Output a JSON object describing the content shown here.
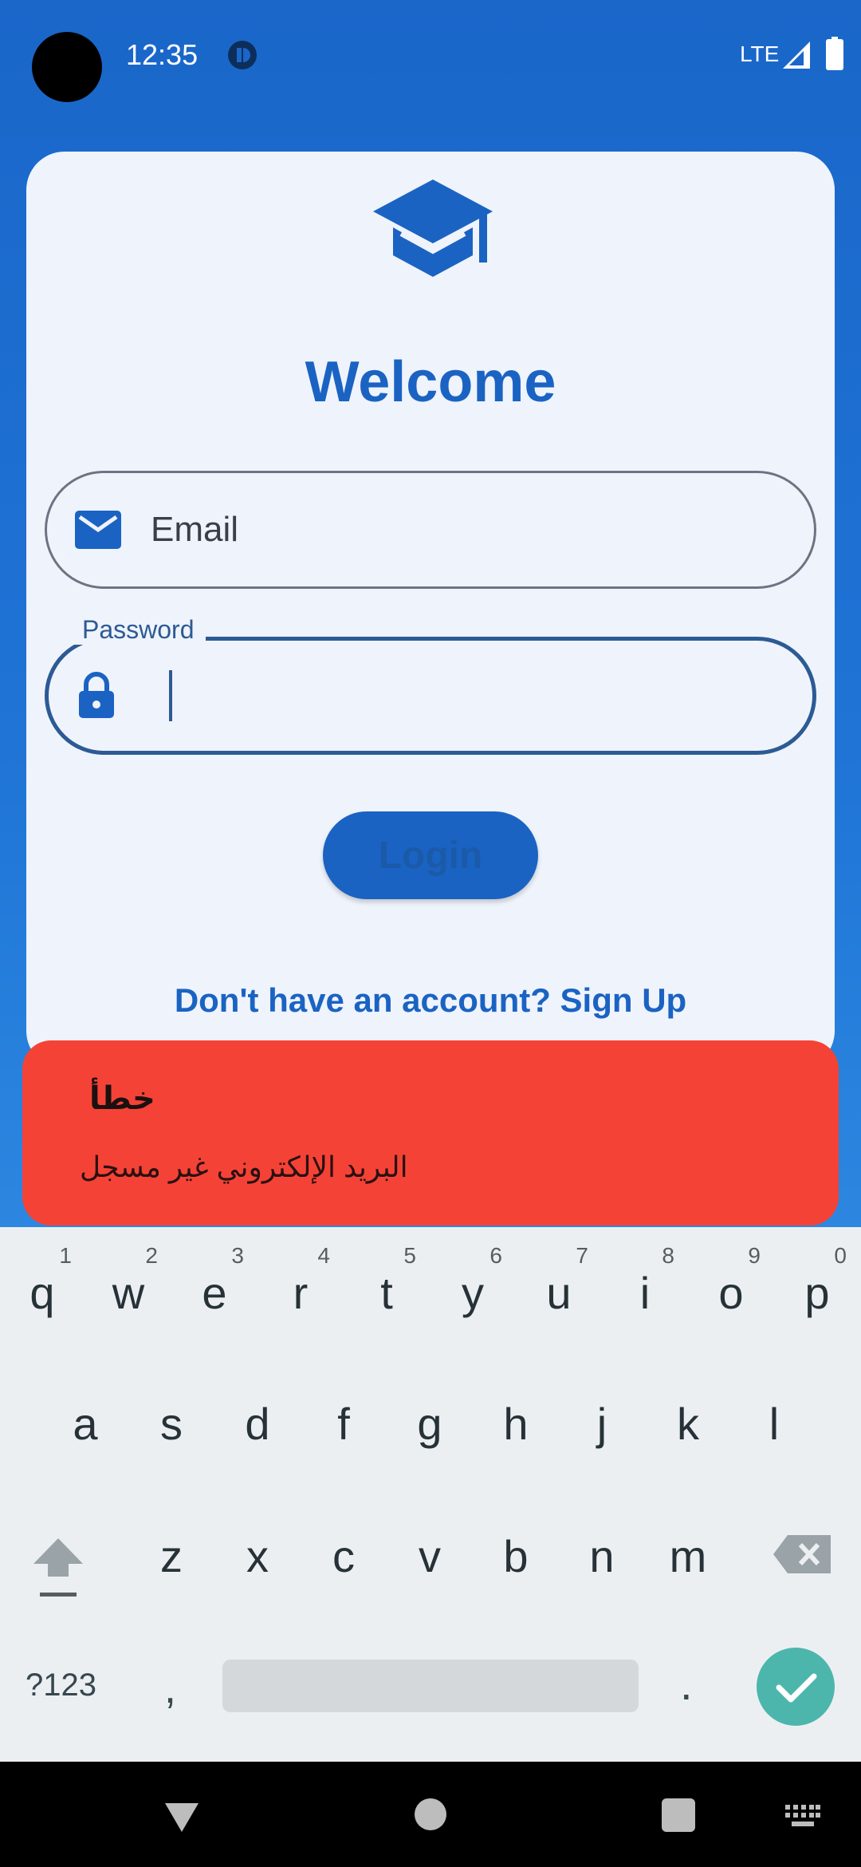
{
  "status_bar": {
    "time": "12:35",
    "network": "LTE"
  },
  "card": {
    "title": "Welcome",
    "email_label": "Email",
    "password_label": "Password",
    "login_label": "Login",
    "signup_text": "Don't have an account? Sign Up"
  },
  "error_toast": {
    "title": "خطأ",
    "message": "البريد الإلكتروني غير مسجل",
    "color": "#f44336"
  },
  "keyboard": {
    "row1": [
      {
        "ch": "q",
        "num": "1"
      },
      {
        "ch": "w",
        "num": "2"
      },
      {
        "ch": "e",
        "num": "3"
      },
      {
        "ch": "r",
        "num": "4"
      },
      {
        "ch": "t",
        "num": "5"
      },
      {
        "ch": "y",
        "num": "6"
      },
      {
        "ch": "u",
        "num": "7"
      },
      {
        "ch": "i",
        "num": "8"
      },
      {
        "ch": "o",
        "num": "9"
      },
      {
        "ch": "p",
        "num": "0"
      }
    ],
    "row2": [
      "a",
      "s",
      "d",
      "f",
      "g",
      "h",
      "j",
      "k",
      "l"
    ],
    "row3": [
      "z",
      "x",
      "c",
      "v",
      "b",
      "n",
      "m"
    ],
    "symbols_label": "?123",
    "comma": ",",
    "period": "."
  },
  "colors": {
    "primary": "#1a63c3",
    "accent_enter": "#4db6ac",
    "error": "#f44336"
  }
}
